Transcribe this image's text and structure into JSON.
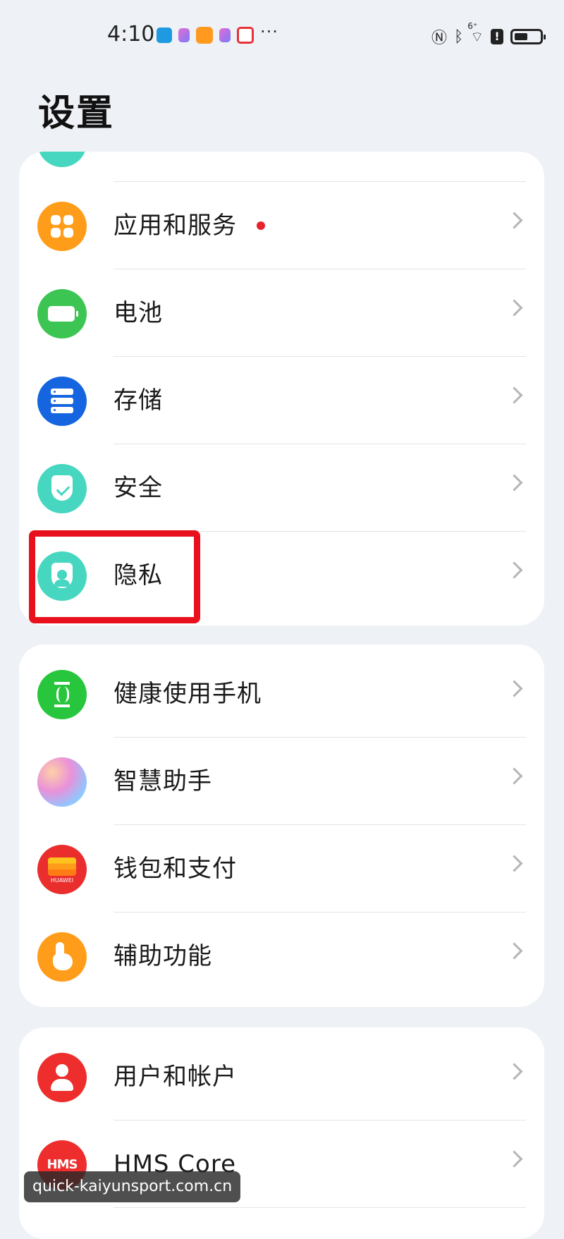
{
  "status_bar": {
    "time": "4:10",
    "more": "···",
    "network_badge": "6⁺",
    "notification_icons": [
      "message-icon",
      "app-cube-icon",
      "orange-app-icon",
      "app-cube-icon",
      "red-app-icon"
    ],
    "system_icons": [
      "nfc-icon",
      "bluetooth-icon",
      "wifi-icon",
      "alert-icon",
      "battery-icon"
    ]
  },
  "page": {
    "title": "设置"
  },
  "groups": [
    {
      "items": [
        {
          "label": "应用和服务",
          "icon": "apps-icon",
          "color": "#ff9d1a",
          "badge": true
        },
        {
          "label": "电池",
          "icon": "battery-icon",
          "color": "#3dc553"
        },
        {
          "label": "存储",
          "icon": "storage-icon",
          "color": "#1565e0"
        },
        {
          "label": "安全",
          "icon": "security-shield-icon",
          "color": "#47d7c0"
        },
        {
          "label": "隐私",
          "icon": "privacy-icon",
          "color": "#47d7c0",
          "highlighted": true
        }
      ]
    },
    {
      "items": [
        {
          "label": "健康使用手机",
          "icon": "hourglass-icon",
          "color": "#27c63c"
        },
        {
          "label": "智慧助手",
          "icon": "assistant-icon",
          "color": "#c88ae6"
        },
        {
          "label": "钱包和支付",
          "icon": "wallet-icon",
          "color": "#ea2d2d",
          "icon_text": "HUAWEI"
        },
        {
          "label": "辅助功能",
          "icon": "accessibility-hand-icon",
          "color": "#ff9d1a"
        }
      ]
    },
    {
      "items": [
        {
          "label": "用户和帐户",
          "icon": "user-icon",
          "color": "#ee2d2d"
        },
        {
          "label": "HMS Core",
          "icon": "hms-core-icon",
          "color": "#ee2d2d",
          "icon_text": "HMS"
        }
      ]
    }
  ],
  "watermark": "quick-kaiyunsport.com.cn",
  "colors": {
    "background": "#eef1f5",
    "card": "#ffffff",
    "highlight": "#e8101c",
    "badge": "#e8212c"
  }
}
